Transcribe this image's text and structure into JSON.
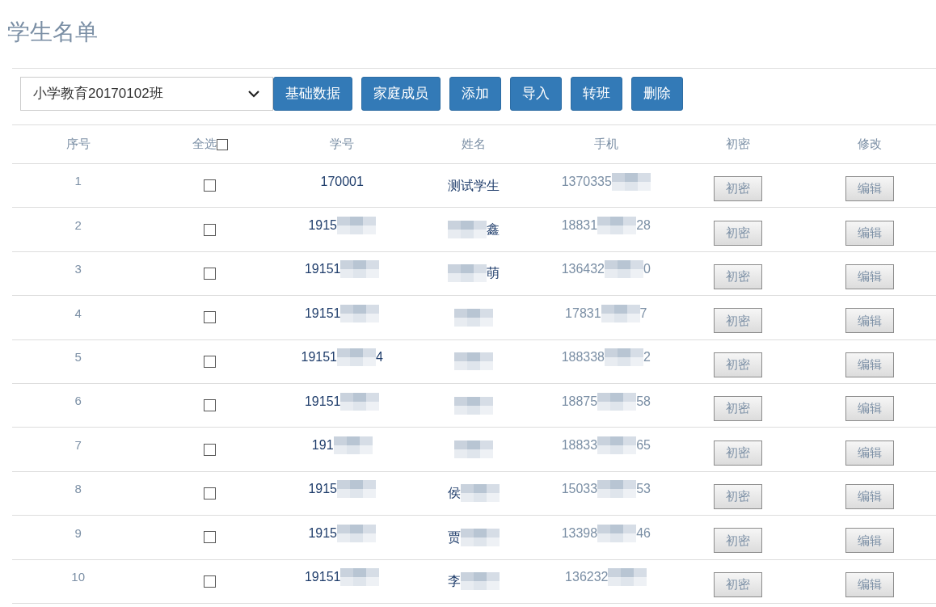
{
  "title": "学生名单",
  "toolbar": {
    "class_select": "小学教育20170102班",
    "buttons": [
      "基础数据",
      "家庭成员",
      "添加",
      "导入",
      "转班",
      "删除"
    ]
  },
  "table": {
    "columns": [
      "序号",
      "全选",
      "学号",
      "姓名",
      "手机",
      "初密",
      "修改"
    ],
    "select_all_checked": false,
    "rows": [
      {
        "index": "1",
        "checked": false,
        "id": {
          "start": "170001",
          "redacted": false
        },
        "name": {
          "start": "测试学生",
          "redacted": false
        },
        "phone": {
          "start": "1370335",
          "redacted": true
        },
        "reset": "初密",
        "edit": "编辑"
      },
      {
        "index": "2",
        "checked": false,
        "id": {
          "start": "1915",
          "redacted": true
        },
        "name": {
          "redacted": true,
          "end": "鑫"
        },
        "phone": {
          "start": "18831",
          "redacted": true,
          "end": "28"
        },
        "reset": "初密",
        "edit": "编辑"
      },
      {
        "index": "3",
        "checked": false,
        "id": {
          "start": "19151",
          "redacted": true
        },
        "name": {
          "redacted": true,
          "end": "萌"
        },
        "phone": {
          "start": "136432",
          "redacted": true,
          "end": "0"
        },
        "reset": "初密",
        "edit": "编辑"
      },
      {
        "index": "4",
        "checked": false,
        "id": {
          "start": "19151",
          "redacted": true
        },
        "name": {
          "redacted": true
        },
        "phone": {
          "start": "17831",
          "redacted": true,
          "end": "7"
        },
        "reset": "初密",
        "edit": "编辑"
      },
      {
        "index": "5",
        "checked": false,
        "id": {
          "start": "19151",
          "redacted": true,
          "end": "4"
        },
        "name": {
          "redacted": true
        },
        "phone": {
          "start": "188338",
          "redacted": true,
          "end": "2"
        },
        "reset": "初密",
        "edit": "编辑"
      },
      {
        "index": "6",
        "checked": false,
        "id": {
          "start": "19151",
          "redacted": true
        },
        "name": {
          "redacted": true
        },
        "phone": {
          "start": "18875",
          "redacted": true,
          "end": "58"
        },
        "reset": "初密",
        "edit": "编辑"
      },
      {
        "index": "7",
        "checked": false,
        "id": {
          "start": "191",
          "redacted": true
        },
        "name": {
          "redacted": true
        },
        "phone": {
          "start": "18833",
          "redacted": true,
          "end": "65"
        },
        "reset": "初密",
        "edit": "编辑"
      },
      {
        "index": "8",
        "checked": false,
        "id": {
          "start": "1915",
          "redacted": true
        },
        "name": {
          "start": "侯",
          "redacted": true
        },
        "phone": {
          "start": "15033",
          "redacted": true,
          "end": "53"
        },
        "reset": "初密",
        "edit": "编辑"
      },
      {
        "index": "9",
        "checked": false,
        "id": {
          "start": "1915",
          "redacted": true
        },
        "name": {
          "start": "贾",
          "redacted": true
        },
        "phone": {
          "start": "13398",
          "redacted": true,
          "end": "46"
        },
        "reset": "初密",
        "edit": "编辑"
      },
      {
        "index": "10",
        "checked": false,
        "id": {
          "start": "19151",
          "redacted": true
        },
        "name": {
          "start": "李",
          "redacted": true
        },
        "phone": {
          "start": "136232",
          "redacted": true
        },
        "reset": "初密",
        "edit": "编辑"
      }
    ]
  }
}
